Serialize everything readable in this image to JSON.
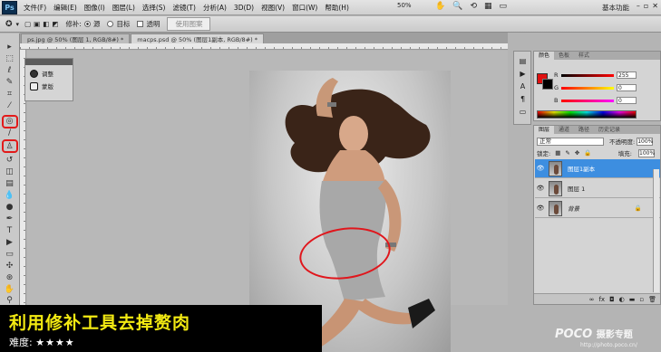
{
  "menubar": {
    "logo": "Ps",
    "items": [
      "文件(F)",
      "编辑(E)",
      "图像(I)",
      "图层(L)",
      "选择(S)",
      "滤镜(T)",
      "分析(A)",
      "3D(D)",
      "视图(V)",
      "窗口(W)",
      "帮助(H)"
    ],
    "zoom": "50%",
    "workspace": "基本功能",
    "window_buttons": [
      "–",
      "▫",
      "✕"
    ]
  },
  "options": {
    "patch_label": "修补:",
    "source_label": "源",
    "target_label": "目标",
    "transparent_label": "透明",
    "use_pattern_label": "使用图案"
  },
  "document": {
    "tabs": [
      "ps.jpg @ 50% (图层 1, RGB/8#) *",
      "macps.psd @ 50% (图层1副本, RGB/8#) *"
    ]
  },
  "mini_panel": {
    "items": [
      "调整",
      "蒙版"
    ]
  },
  "color_panel": {
    "tabs": [
      "颜色",
      "色板",
      "样式"
    ],
    "r_label": "R",
    "g_label": "G",
    "b_label": "B",
    "r_value": "255",
    "g_value": "0",
    "b_value": "0",
    "foreground": "#e01010",
    "background": "#000000"
  },
  "layers_panel": {
    "tabs": [
      "图层",
      "通道",
      "路径",
      "历史记录"
    ],
    "blend_mode": "正常",
    "opacity_label": "不透明度:",
    "opacity_value": "100%",
    "lock_label": "锁定:",
    "fill_label": "填充:",
    "fill_value": "100%",
    "layers": [
      {
        "name": "图层1副本",
        "selected": true
      },
      {
        "name": "图层 1",
        "selected": false
      },
      {
        "name": "背景",
        "selected": false,
        "locked": true
      }
    ]
  },
  "caption": {
    "title": "利用修补工具去掉赘肉",
    "difficulty_label": "难度:",
    "stars": "★★★★"
  },
  "watermark": {
    "brand": "POCO",
    "brand_cn": "摄影专题",
    "url": "http://photo.poco.cn/"
  }
}
